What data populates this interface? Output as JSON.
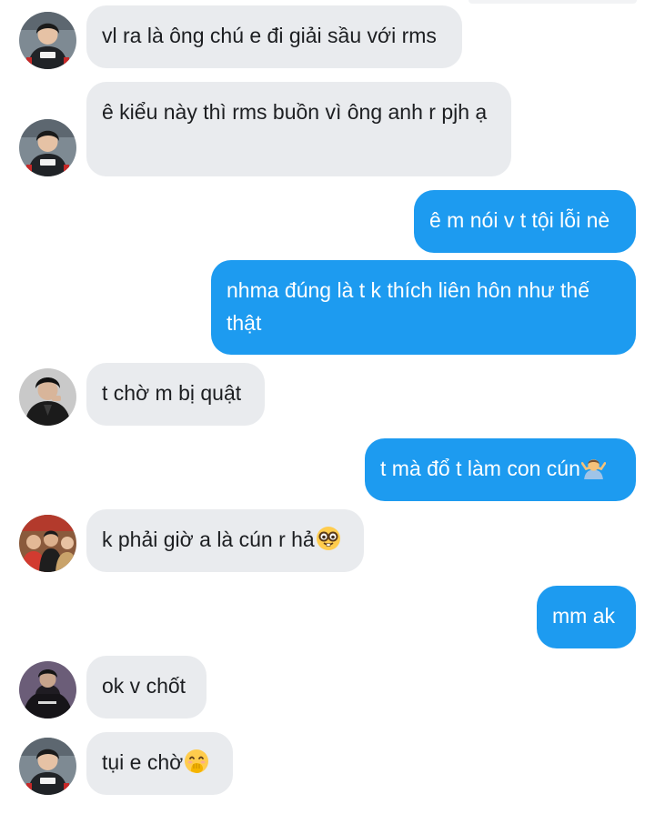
{
  "conversation": {
    "messages": [
      {
        "sender": "contact",
        "text": "vl ra là ông chú e đi giải sầu với rms"
      },
      {
        "sender": "contact",
        "text": "ê kiểu này thì rms buồn vì ông anh r pjh ạ"
      },
      {
        "sender": "me",
        "text": "ê m nói v t tội lỗi nè"
      },
      {
        "sender": "me",
        "text": "nhma đúng là t k thích liên hôn như thế thật"
      },
      {
        "sender": "contact",
        "text": "t chờ m bị quật"
      },
      {
        "sender": "me",
        "text": "t mà đổ t làm con cún",
        "emoji": "shrug-emoji"
      },
      {
        "sender": "contact",
        "text": "k phải giờ a là cún r hả",
        "emoji": "nerd-face-emoji"
      },
      {
        "sender": "me",
        "text": "mm ak"
      },
      {
        "sender": "contact",
        "text": "ok v chốt"
      },
      {
        "sender": "contact",
        "text": "tụi e chờ",
        "emoji": "hand-over-mouth-emoji"
      }
    ]
  },
  "colors": {
    "incoming_bubble": "#e9ebee",
    "outgoing_bubble": "#1d9bf0",
    "incoming_text": "#1c1e21",
    "outgoing_text": "#ffffff"
  }
}
